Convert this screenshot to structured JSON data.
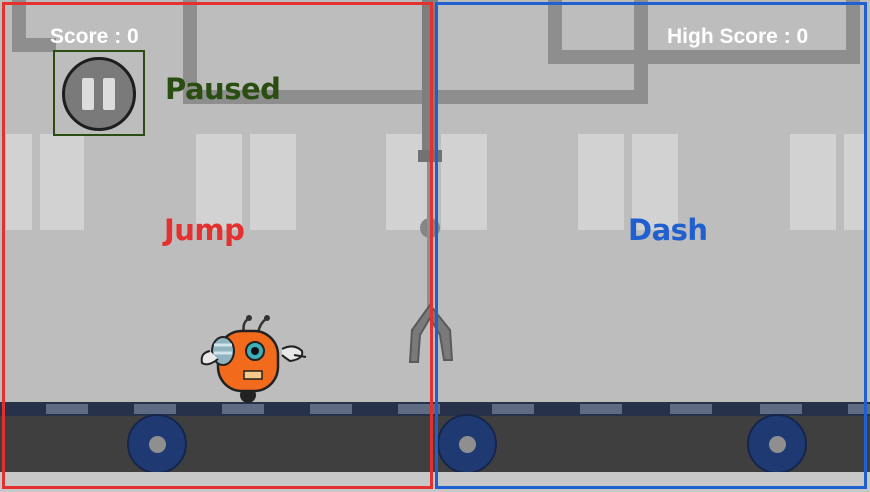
{
  "hud": {
    "score_label": "Score : 0",
    "high_score_label": "High Score : 0"
  },
  "status": {
    "paused_label": "Paused"
  },
  "zones": {
    "jump_label": "Jump",
    "dash_label": "Dash"
  },
  "colors": {
    "jump_zone": "#e2312f",
    "dash_zone": "#1f5fd0",
    "paused_text": "#2a4e12",
    "robot_body": "#f26b1d"
  },
  "icons": {
    "pause": "pause-icon",
    "robot": "robot-character"
  }
}
